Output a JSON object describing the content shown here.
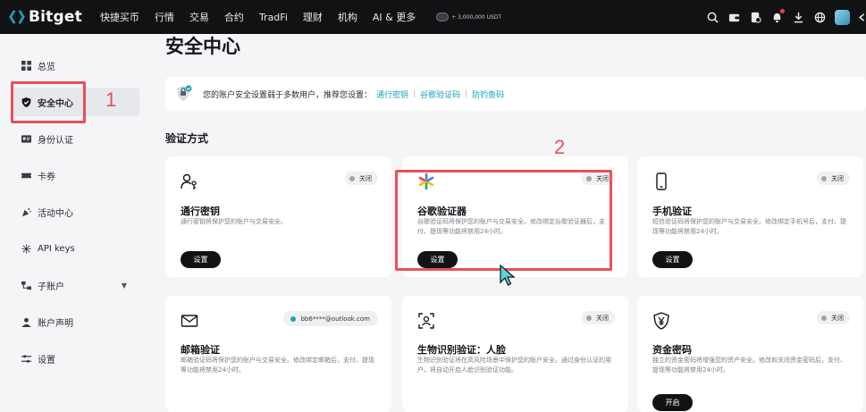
{
  "topbar": {
    "logo_text": "Bitget",
    "nav": [
      "快捷买币",
      "行情",
      "交易",
      "合约",
      "TradFi",
      "理财",
      "机构",
      "AI & 更多"
    ],
    "promo_text": "+ 3,000,000 USDT",
    "icons": [
      "search-icon",
      "wallet-icon",
      "orders-icon",
      "bell-icon",
      "download-icon",
      "globe-icon",
      "avatar-icon",
      "arrow-icon"
    ]
  },
  "sidebar": {
    "items": [
      {
        "label": "总览",
        "icon": "grid-icon"
      },
      {
        "label": "安全中心",
        "icon": "shield-icon"
      },
      {
        "label": "身份认证",
        "icon": "id-card-icon"
      },
      {
        "label": "卡券",
        "icon": "ticket-icon"
      },
      {
        "label": "活动中心",
        "icon": "party-icon"
      },
      {
        "label": "API keys",
        "icon": "api-icon"
      },
      {
        "label": "子账户",
        "icon": "sub-account-icon"
      },
      {
        "label": "账户声明",
        "icon": "user-icon"
      },
      {
        "label": "设置",
        "icon": "settings-icon"
      }
    ]
  },
  "annotations": {
    "label_1": "1",
    "label_2": "2"
  },
  "main": {
    "title": "安全中心",
    "banner": {
      "text": "您的账户安全设置弱于多数用户，推荐您设置：",
      "links": [
        "通行密钥",
        "谷歌验证码",
        "防钓鱼码"
      ],
      "separator": "|"
    },
    "section_title": "验证方式",
    "cards": [
      {
        "title": "通行密钥",
        "desc": "通行密钥将保护您的账户与交易安全。",
        "badge": "关闭",
        "button": "设置",
        "icon": "passkey-icon"
      },
      {
        "title": "谷歌验证器",
        "desc": "谷歌验证码将保护您的账户与交易安全。修改绑定谷歌验证器后，支付、提现等功能将禁用24小时。",
        "badge": "关闭",
        "button": "设置",
        "icon": "google-authenticator-icon"
      },
      {
        "title": "手机验证",
        "desc": "短信验证码将保护您的账户与交易安全。修改绑定手机号后，支付、提现等功能将禁用24小时。",
        "badge": "关闭",
        "button": "设置",
        "icon": "phone-icon"
      },
      {
        "title": "邮箱验证",
        "desc": "邮箱验证码将保护您的账户与交易安全。修改绑定邮箱后，支付、提现等功能将禁用24小时。",
        "badge": "bb6****@outlook.com",
        "button": "",
        "icon": "mail-icon"
      },
      {
        "title": "生物识别验证：人脸",
        "desc": "生物识别验证将在高风险场景中保护您的账户安全。通过身份认证的用户，将自动开启人脸识别验证功能。",
        "badge": "关闭",
        "button": "",
        "icon": "face-scan-icon"
      },
      {
        "title": "资金密码",
        "desc": "独立的资金密码将增强您的资产安全。修改和关闭资金密码后，支付、提现等功能将禁用24小时。",
        "badge": "关闭",
        "button": "开启",
        "icon": "yen-icon"
      }
    ]
  },
  "colors": {
    "accent": "#1ba2b8",
    "annotation": "#e8505a",
    "topbar": "#111214"
  }
}
